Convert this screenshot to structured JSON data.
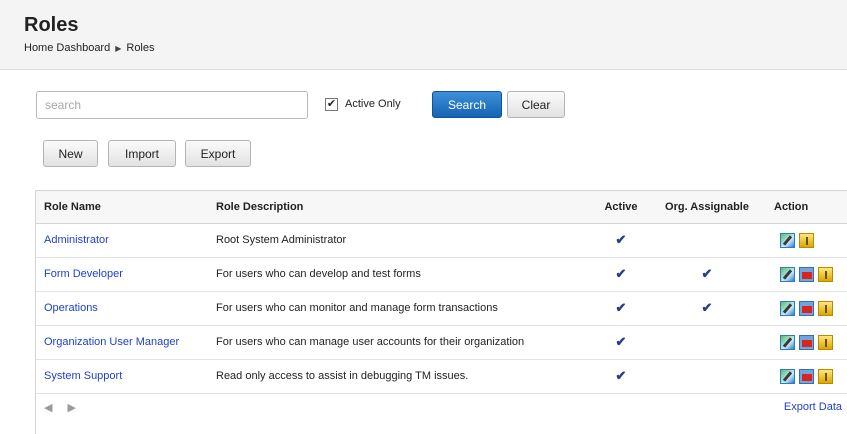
{
  "header": {
    "title": "Roles",
    "breadcrumb": {
      "home": "Home Dashboard",
      "separator": "▶",
      "current": "Roles"
    }
  },
  "search": {
    "placeholder": "search",
    "value": ""
  },
  "active_only": {
    "label": "Active Only",
    "checked": true
  },
  "buttons": {
    "search": "Search",
    "clear": "Clear",
    "new": "New",
    "import": "Import",
    "export": "Export"
  },
  "table": {
    "columns": [
      "Role Name",
      "Role Description",
      "Active",
      "Org. Assignable",
      "Action"
    ],
    "rows": [
      {
        "name": "Administrator",
        "description": "Root System Administrator",
        "active": "✔",
        "org_assignable": "",
        "actions": [
          "edit-icon",
          "info-icon"
        ]
      },
      {
        "name": "Form Developer",
        "description": "For users who can develop and test forms",
        "active": "✔",
        "org_assignable": "✔",
        "actions": [
          "edit-icon",
          "delete-icon",
          "info-icon"
        ]
      },
      {
        "name": "Operations",
        "description": "For users who can monitor and manage form transactions",
        "active": "✔",
        "org_assignable": "✔",
        "actions": [
          "edit-icon",
          "delete-icon",
          "info-icon"
        ]
      },
      {
        "name": "Organization User Manager",
        "description": "For users who can manage user accounts for their organization",
        "active": "✔",
        "org_assignable": "",
        "actions": [
          "edit-icon",
          "delete-icon",
          "info-icon"
        ]
      },
      {
        "name": "System Support",
        "description": "Read only access to assist in debugging TM issues.",
        "active": "✔",
        "org_assignable": "",
        "actions": [
          "edit-icon",
          "delete-icon",
          "info-icon"
        ]
      }
    ],
    "pager": "◀ ▶",
    "export_data": "Export Data"
  },
  "colors": {
    "link": "#1f3fcf",
    "primary_button": "#1f6fc4",
    "header_bg": "#f4f4f4"
  }
}
